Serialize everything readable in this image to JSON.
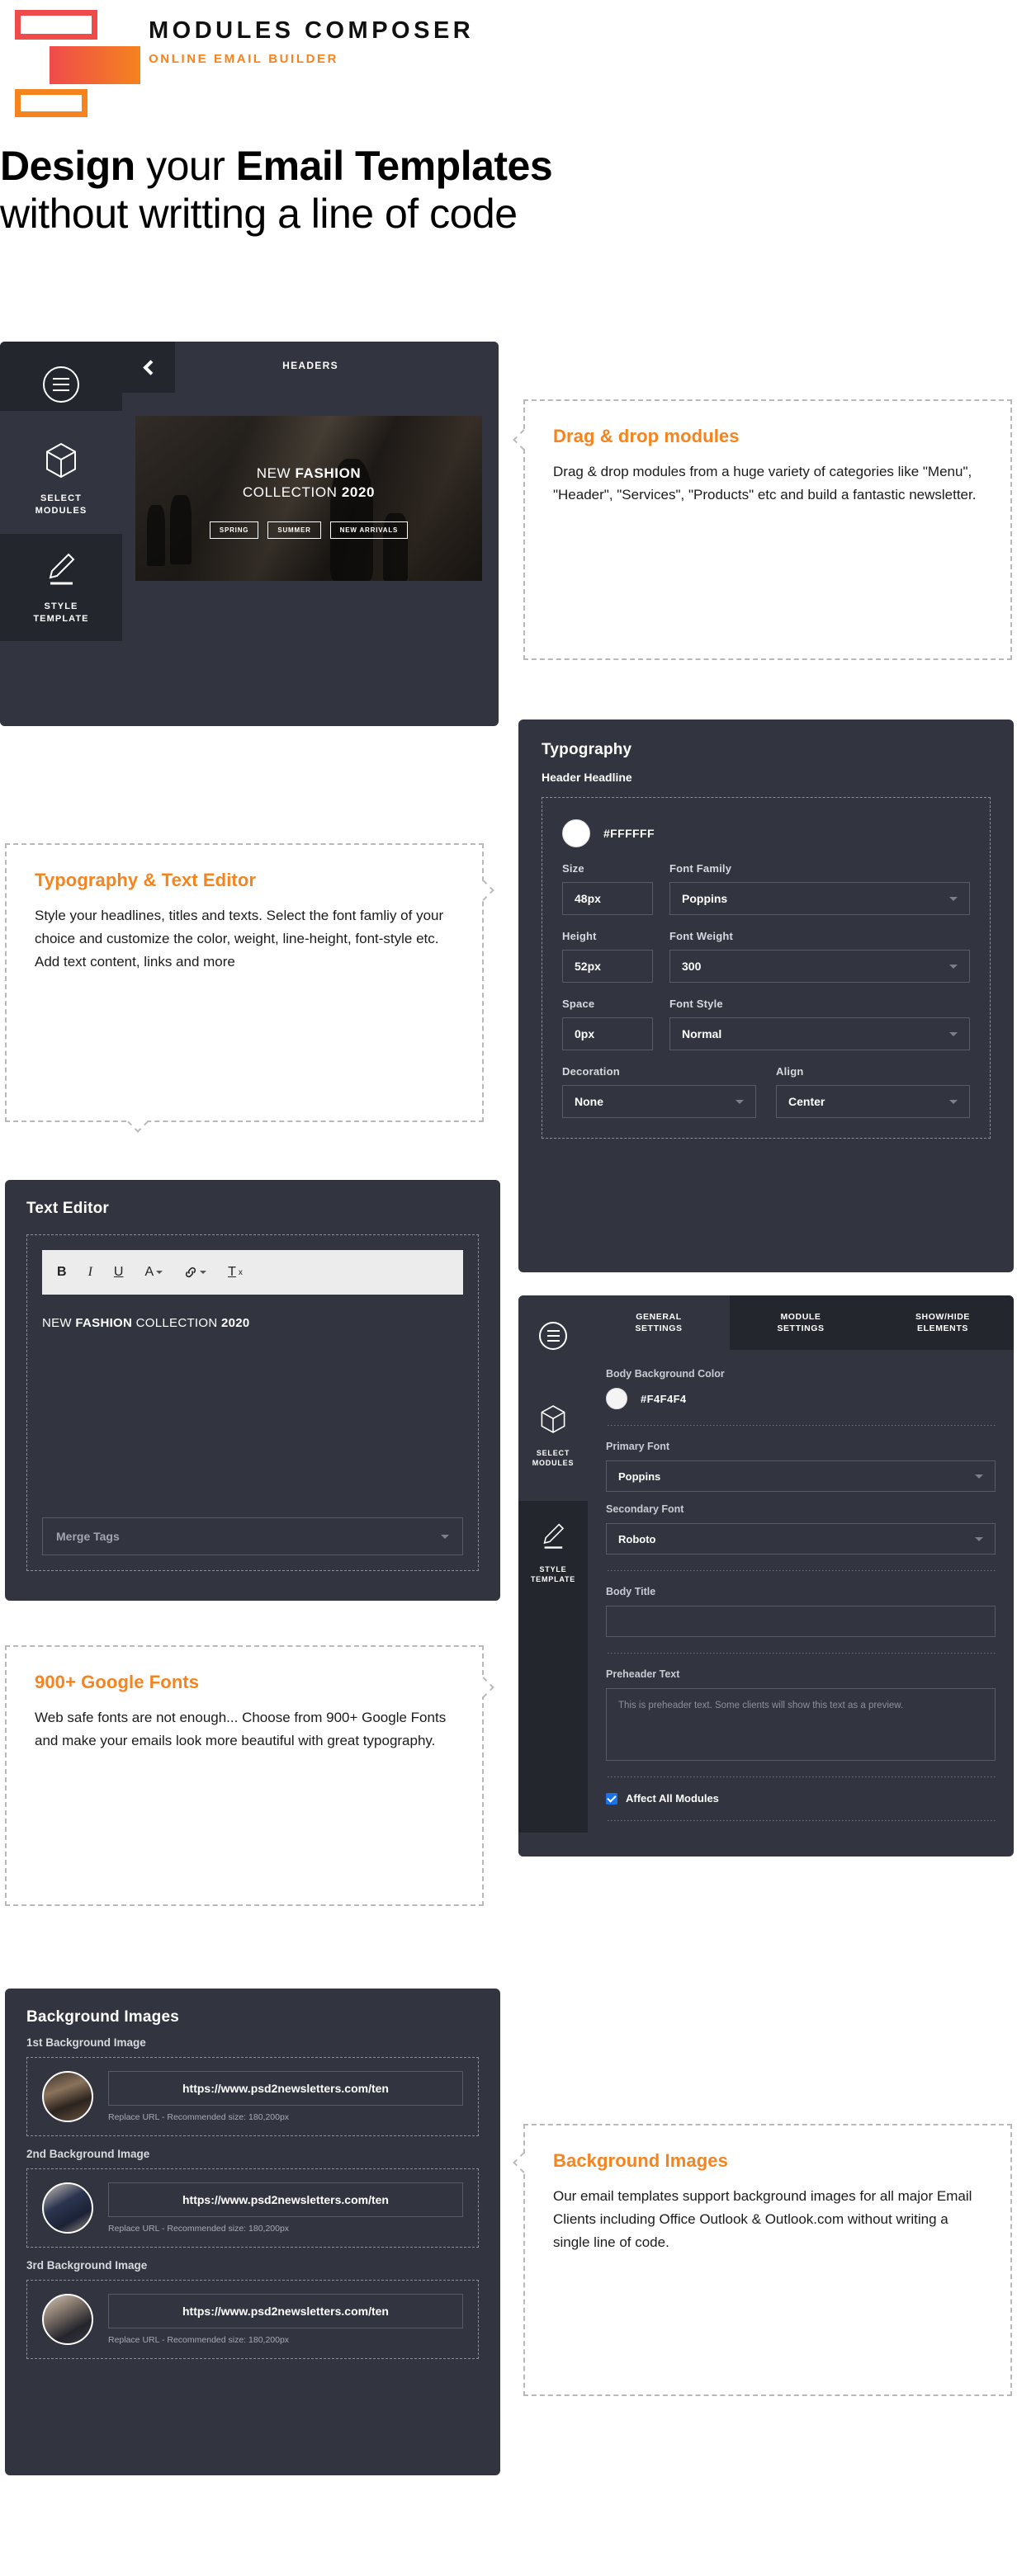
{
  "brand": {
    "title": "MODULES COMPOSER",
    "subtitle": "ONLINE EMAIL BUILDER"
  },
  "hero": {
    "line1_a": "Design",
    "line1_b": " your ",
    "line1_c": "Email Templates",
    "line2": "without writting a line of code"
  },
  "builder_rail": {
    "menu_icon": "hamburger-circle-icon",
    "items": [
      {
        "icon": "cube-icon",
        "label": "SELECT\nMODULES",
        "label_line1": "SELECT",
        "label_line2": "MODULES"
      },
      {
        "icon": "pencil-icon",
        "label": "STYLE\nTEMPLATE",
        "label_line1": "STYLE",
        "label_line2": "TEMPLATE"
      }
    ]
  },
  "headers_panel": {
    "back_icon": "chevron-left-icon",
    "title": "HEADERS",
    "preview": {
      "line1_plain": "NEW ",
      "line1_bold": "FASHION",
      "line2_plain": "COLLECTION ",
      "line2_bold": "2020",
      "tags": [
        "SPRING",
        "SUMMER",
        "NEW ARRIVALS"
      ]
    }
  },
  "callouts": {
    "drag": {
      "heading": "Drag & drop modules",
      "body": "Drag & drop modules from a huge variety of categories like \"Menu\", \"Header\", \"Services\", \"Products\" etc and build a fantastic newsletter."
    },
    "typography": {
      "heading": "Typography & Text Editor",
      "body": "Style your headlines, titles and texts. Select the font famliy of your choice and customize the color, weight, line-height, font-style etc. Add text content, links and more"
    },
    "fonts": {
      "heading": "900+ Google Fonts",
      "body": "Web safe fonts are not enough... Choose from 900+ Google Fonts and make your emails look more beautiful with great typography."
    },
    "background": {
      "heading": "Background Images",
      "body": "Our email templates support background images for all major Email Clients including Office Outlook & Outlook.com without writing a single line of code."
    }
  },
  "typography_panel": {
    "title": "Typography",
    "section_label": "Header Headline",
    "color_value": "#FFFFFF",
    "color_swatch": "#FFFFFF",
    "fields": {
      "size_label": "Size",
      "size_value": "48px",
      "font_family_label": "Font Family",
      "font_family_value": "Poppins",
      "height_label": "Height",
      "height_value": "52px",
      "font_weight_label": "Font Weight",
      "font_weight_value": "300",
      "space_label": "Space",
      "space_value": "0px",
      "font_style_label": "Font Style",
      "font_style_value": "Normal",
      "decoration_label": "Decoration",
      "decoration_value": "None",
      "align_label": "Align",
      "align_value": "Center"
    }
  },
  "text_editor_panel": {
    "title": "Text Editor",
    "toolbar": [
      {
        "icon": "bold-icon",
        "label": "B"
      },
      {
        "icon": "italic-icon",
        "label": "I"
      },
      {
        "icon": "underline-icon",
        "label": "U"
      },
      {
        "icon": "text-color-icon",
        "label": "A"
      },
      {
        "icon": "link-icon",
        "label": "&"
      },
      {
        "icon": "clear-format-icon",
        "label": "T"
      }
    ],
    "content_plain_1": "NEW ",
    "content_bold_1": "FASHION",
    "content_plain_2": " COLLECTION ",
    "content_bold_2": "2020",
    "merge_tags_label": "Merge Tags"
  },
  "style_panel": {
    "tabs": [
      {
        "label_line1": "GENERAL",
        "label_line2": "SETTINGS",
        "active": true
      },
      {
        "label_line1": "MODULE",
        "label_line2": "SETTINGS",
        "active": false
      },
      {
        "label_line1": "SHOW/HIDE",
        "label_line2": "ELEMENTS",
        "active": false
      }
    ],
    "body_background_color_label": "Body Background Color",
    "body_background_color_value": "#F4F4F4",
    "primary_font_label": "Primary Font",
    "primary_font_value": "Poppins",
    "secondary_font_label": "Secondary Font",
    "secondary_font_value": "Roboto",
    "body_title_label": "Body Title",
    "body_title_value": "",
    "preheader_label": "Preheader Text",
    "preheader_placeholder": "This is preheader text. Some clients will show this text as a preview.",
    "affect_all_label": "Affect All Modules",
    "affect_all_checked": true
  },
  "background_panel": {
    "title": "Background Images",
    "rows": [
      {
        "label": "1st Background Image",
        "url": "https://www.psd2newsletters.com/ten",
        "hint": "Replace URL - Recommended size: 180,200px"
      },
      {
        "label": "2nd Background Image",
        "url": "https://www.psd2newsletters.com/ten",
        "hint": "Replace URL - Recommended size: 180,200px"
      },
      {
        "label": "3rd Background Image",
        "url": "https://www.psd2newsletters.com/ten",
        "hint": "Replace URL - Recommended size: 180,200px"
      }
    ]
  },
  "colors": {
    "accent_orange": "#F5841F",
    "accent_red": "#EF4B4B",
    "panel_bg": "#32353F",
    "rail_bg": "#24262E"
  }
}
